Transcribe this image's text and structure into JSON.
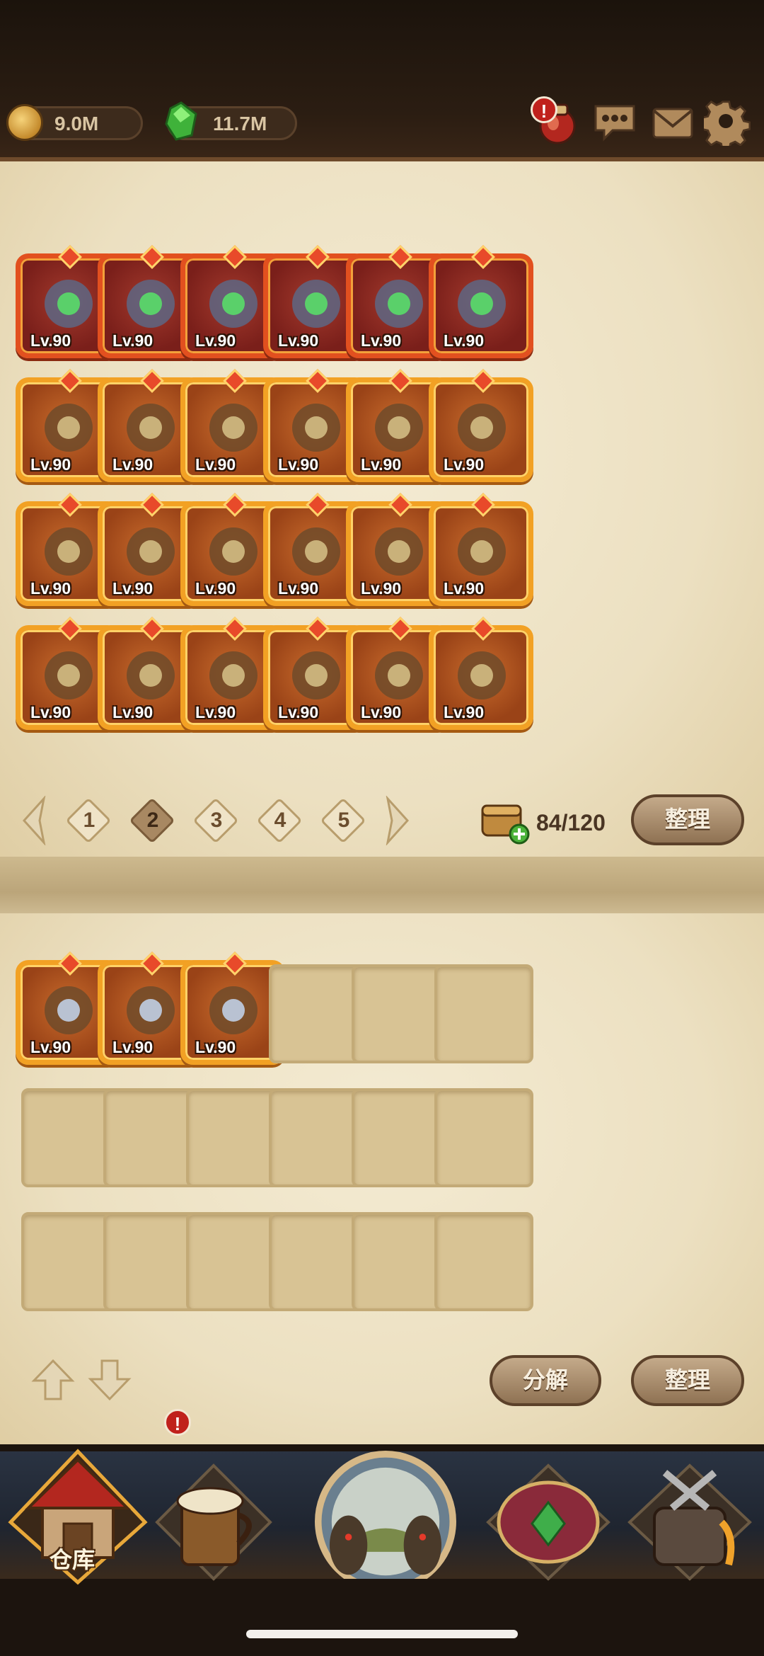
{
  "header": {
    "gold": "9.0M",
    "gems": "11.7M",
    "icons": [
      "potion-icon",
      "chat-icon",
      "mail-icon",
      "settings-icon"
    ],
    "alert": "!"
  },
  "inventory": {
    "items": [
      {
        "level": "Lv.90",
        "rarity": "red",
        "icon": "amulet-red-icon"
      },
      {
        "level": "Lv.90",
        "rarity": "red",
        "icon": "green-gem-necklace-icon"
      },
      {
        "level": "Lv.90",
        "rarity": "red",
        "icon": "chain-gem-necklace-icon"
      },
      {
        "level": "Lv.90",
        "rarity": "red",
        "icon": "steel-armor-icon"
      },
      {
        "level": "Lv.90",
        "rarity": "red",
        "icon": "chained-armor-icon"
      },
      {
        "level": "Lv.90",
        "rarity": "red",
        "icon": "demon-armor-icon"
      },
      {
        "level": "Lv.90",
        "rarity": "orange",
        "icon": "dagger-icon"
      },
      {
        "level": "Lv.90",
        "rarity": "orange",
        "icon": "wooden-bucket-icon"
      },
      {
        "level": "Lv.90",
        "rarity": "orange",
        "icon": "spellbook-icon"
      },
      {
        "level": "Lv.90",
        "rarity": "orange",
        "icon": "kunai-icon"
      },
      {
        "level": "Lv.90",
        "rarity": "orange",
        "icon": "tribal-mask-icon"
      },
      {
        "level": "Lv.90",
        "rarity": "orange",
        "icon": "knight-helm-icon"
      },
      {
        "level": "Lv.90",
        "rarity": "orange",
        "icon": "fur-helmet-icon"
      },
      {
        "level": "Lv.90",
        "rarity": "orange",
        "icon": "red-pendant-icon"
      },
      {
        "level": "Lv.90",
        "rarity": "orange",
        "icon": "crystal-necklace-icon"
      },
      {
        "level": "Lv.90",
        "rarity": "orange",
        "icon": "blue-cloak-icon"
      },
      {
        "level": "Lv.90",
        "rarity": "orange",
        "icon": "dark-armor-icon"
      },
      {
        "level": "Lv.90",
        "rarity": "orange",
        "icon": "blue-cloak-icon"
      },
      {
        "level": "Lv.90",
        "rarity": "orange",
        "icon": "purple-glove-icon"
      },
      {
        "level": "Lv.90",
        "rarity": "orange",
        "icon": "leather-glove-icon"
      },
      {
        "level": "Lv.90",
        "rarity": "orange",
        "icon": "ruby-bracelet-icon"
      },
      {
        "level": "Lv.90",
        "rarity": "orange",
        "icon": "orb-ring-icon"
      },
      {
        "level": "Lv.90",
        "rarity": "orange",
        "icon": "amethyst-ring-icon"
      },
      {
        "level": "Lv.90",
        "rarity": "orange",
        "icon": "plate-armor-icon"
      }
    ],
    "pages": [
      "1",
      "2",
      "3",
      "4",
      "5"
    ],
    "active_page": "2",
    "capacity": "84/120",
    "sort_label": "整理"
  },
  "stash": {
    "items": [
      {
        "level": "Lv.90",
        "rarity": "orange",
        "icon": "sword-icon"
      },
      {
        "level": "Lv.90",
        "rarity": "orange",
        "icon": "fang-necklace-icon"
      },
      {
        "level": "Lv.90",
        "rarity": "orange",
        "icon": "claw-icon"
      }
    ],
    "empty_slots": 15,
    "decompose_label": "分解",
    "sort_label": "整理"
  },
  "nav": {
    "home_label": "仓库",
    "items": [
      "warehouse-icon",
      "tavern-icon",
      "portal-icon",
      "shrine-icon",
      "forge-icon"
    ]
  },
  "colors": {
    "red_frame": "#e2501f",
    "orange_frame": "#f2a124",
    "parchment": "#ece0c1"
  }
}
